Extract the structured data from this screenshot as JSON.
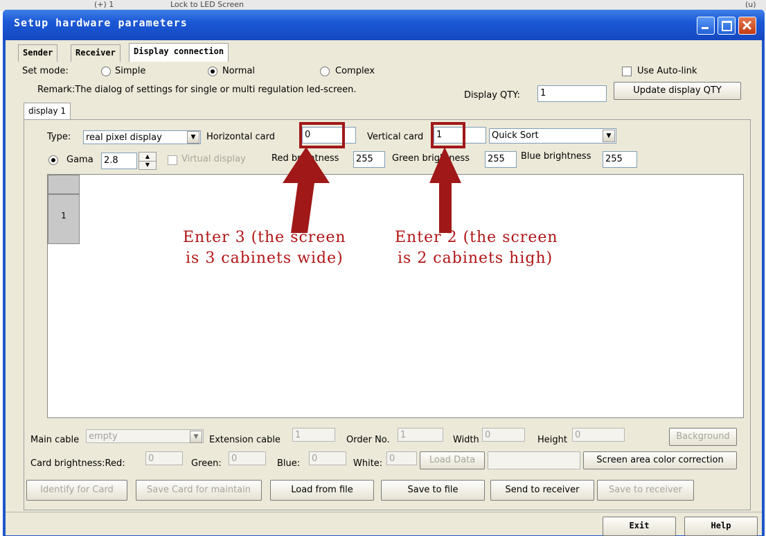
{
  "behind_window": {
    "item1": "(+)  1",
    "item2": "Lock to LED Screen",
    "item3": "(u)"
  },
  "window": {
    "title": "Setup hardware parameters"
  },
  "tabs": [
    "Sender",
    "Receiver",
    "Display connection"
  ],
  "set_mode": {
    "label": "Set mode:",
    "options": [
      "Simple",
      "Normal",
      "Complex"
    ],
    "selected": "Normal"
  },
  "use_auto_link": "Use Auto-link",
  "remark": "Remark:The dialog of settings for single or multi  regulation led-screen.",
  "display_qty": {
    "label": "Display QTY:",
    "value": "1",
    "button": "Update display QTY"
  },
  "display_tab": "display 1",
  "type": {
    "label": "Type:",
    "value": "real pixel display"
  },
  "horizontal_card": {
    "label": "Horizontal card",
    "value": "0"
  },
  "vertical_card": {
    "label": "Vertical card",
    "value": "1"
  },
  "sort": {
    "value": "Quick Sort"
  },
  "gama": {
    "label": "Gama",
    "value": "2.8"
  },
  "virtual_display": "Virtual display",
  "red_brightness": {
    "label": "Red brightness",
    "value": "255"
  },
  "green_brightness": {
    "label": "Green brightness",
    "value": "255"
  },
  "blue_brightness": {
    "label": "Blue brightness",
    "value": "255"
  },
  "grid": {
    "row_header": "1"
  },
  "annotations": {
    "left_line1": "Enter 3 (the screen",
    "left_line2": "is 3 cabinets wide)",
    "right_line1": "Enter 2 (the screen",
    "right_line2": "is 2 cabinets high)"
  },
  "row1": {
    "main_cable_label": "Main cable",
    "main_cable_value": "empty",
    "extension_cable_label": "Extension cable",
    "extension_cable_value": "1",
    "order_no_label": "Order No.",
    "order_no_value": "1",
    "width_label": "Width",
    "width_value": "0",
    "height_label": "Height",
    "height_value": "0",
    "background_button": "Background"
  },
  "row2": {
    "card_red_label": "Card brightness:Red:",
    "card_red_value": "0",
    "green_label": "Green:",
    "green_value": "0",
    "blue_label": "Blue:",
    "blue_value": "0",
    "white_label": "White:",
    "white_value": "0",
    "load_data_button": "Load Data",
    "color_correction_button": "Screen area color correction"
  },
  "bottom_buttons": [
    "Identify for Card",
    "Save Card for maintain",
    "Load from file",
    "Save to file",
    "Send to receiver",
    "Save to receiver"
  ],
  "footer": {
    "exit": "Exit",
    "help": "Help"
  },
  "colors": {
    "titlebar": "#1b58d6",
    "annotation": "#b11414",
    "dialog": "#ece9d8"
  }
}
